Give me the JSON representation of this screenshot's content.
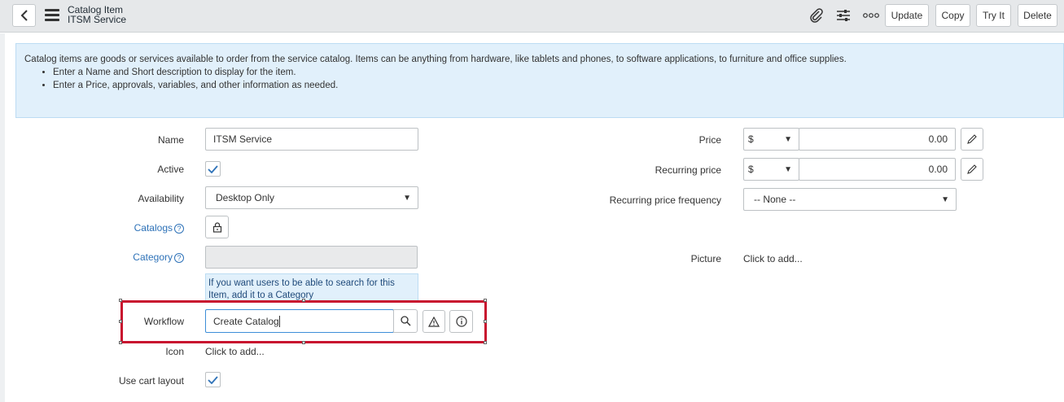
{
  "header": {
    "title": "Catalog Item",
    "subtitle": "ITSM Service",
    "icons": [
      "back-icon",
      "menu-icon",
      "paperclip-icon",
      "settings-sliders-icon",
      "more-icon"
    ],
    "buttons": {
      "update": "Update",
      "copy": "Copy",
      "try_it": "Try It",
      "delete": "Delete"
    }
  },
  "info": {
    "text": "Catalog items are goods or services available to order from the service catalog. Items can be anything from hardware, like tablets and phones, to software applications, to furniture and office supplies.",
    "bullets": [
      "Enter a Name and Short description to display for the item.",
      "Enter a Price, approvals, variables, and other information as needed."
    ]
  },
  "form": {
    "name": {
      "label": "Name",
      "value": "ITSM Service"
    },
    "active": {
      "label": "Active",
      "checked": true
    },
    "availability": {
      "label": "Availability",
      "value": "Desktop Only"
    },
    "catalogs": {
      "label": "Catalogs",
      "help": "?"
    },
    "category": {
      "label": "Category",
      "help": "?",
      "value": ""
    },
    "category_hint": "If you want users to be able to search for this Item, add it to a Category",
    "workflow": {
      "label": "Workflow",
      "value": "Create Catalog"
    },
    "icon": {
      "label": "Icon",
      "value": "Click to add..."
    },
    "use_cart_layout": {
      "label": "Use cart layout",
      "checked": true
    },
    "price": {
      "label": "Price",
      "currency": "$",
      "value": "0.00"
    },
    "recurring_price": {
      "label": "Recurring price",
      "currency": "$",
      "value": "0.00"
    },
    "recurring_price_frequency": {
      "label": "Recurring price frequency",
      "value": "-- None --"
    },
    "picture": {
      "label": "Picture",
      "value": "Click to add..."
    }
  },
  "colors": {
    "header_bg": "#e6e8ea",
    "info_bg": "#e1f0fb",
    "link": "#2e72b8",
    "highlight": "#c8102e"
  }
}
